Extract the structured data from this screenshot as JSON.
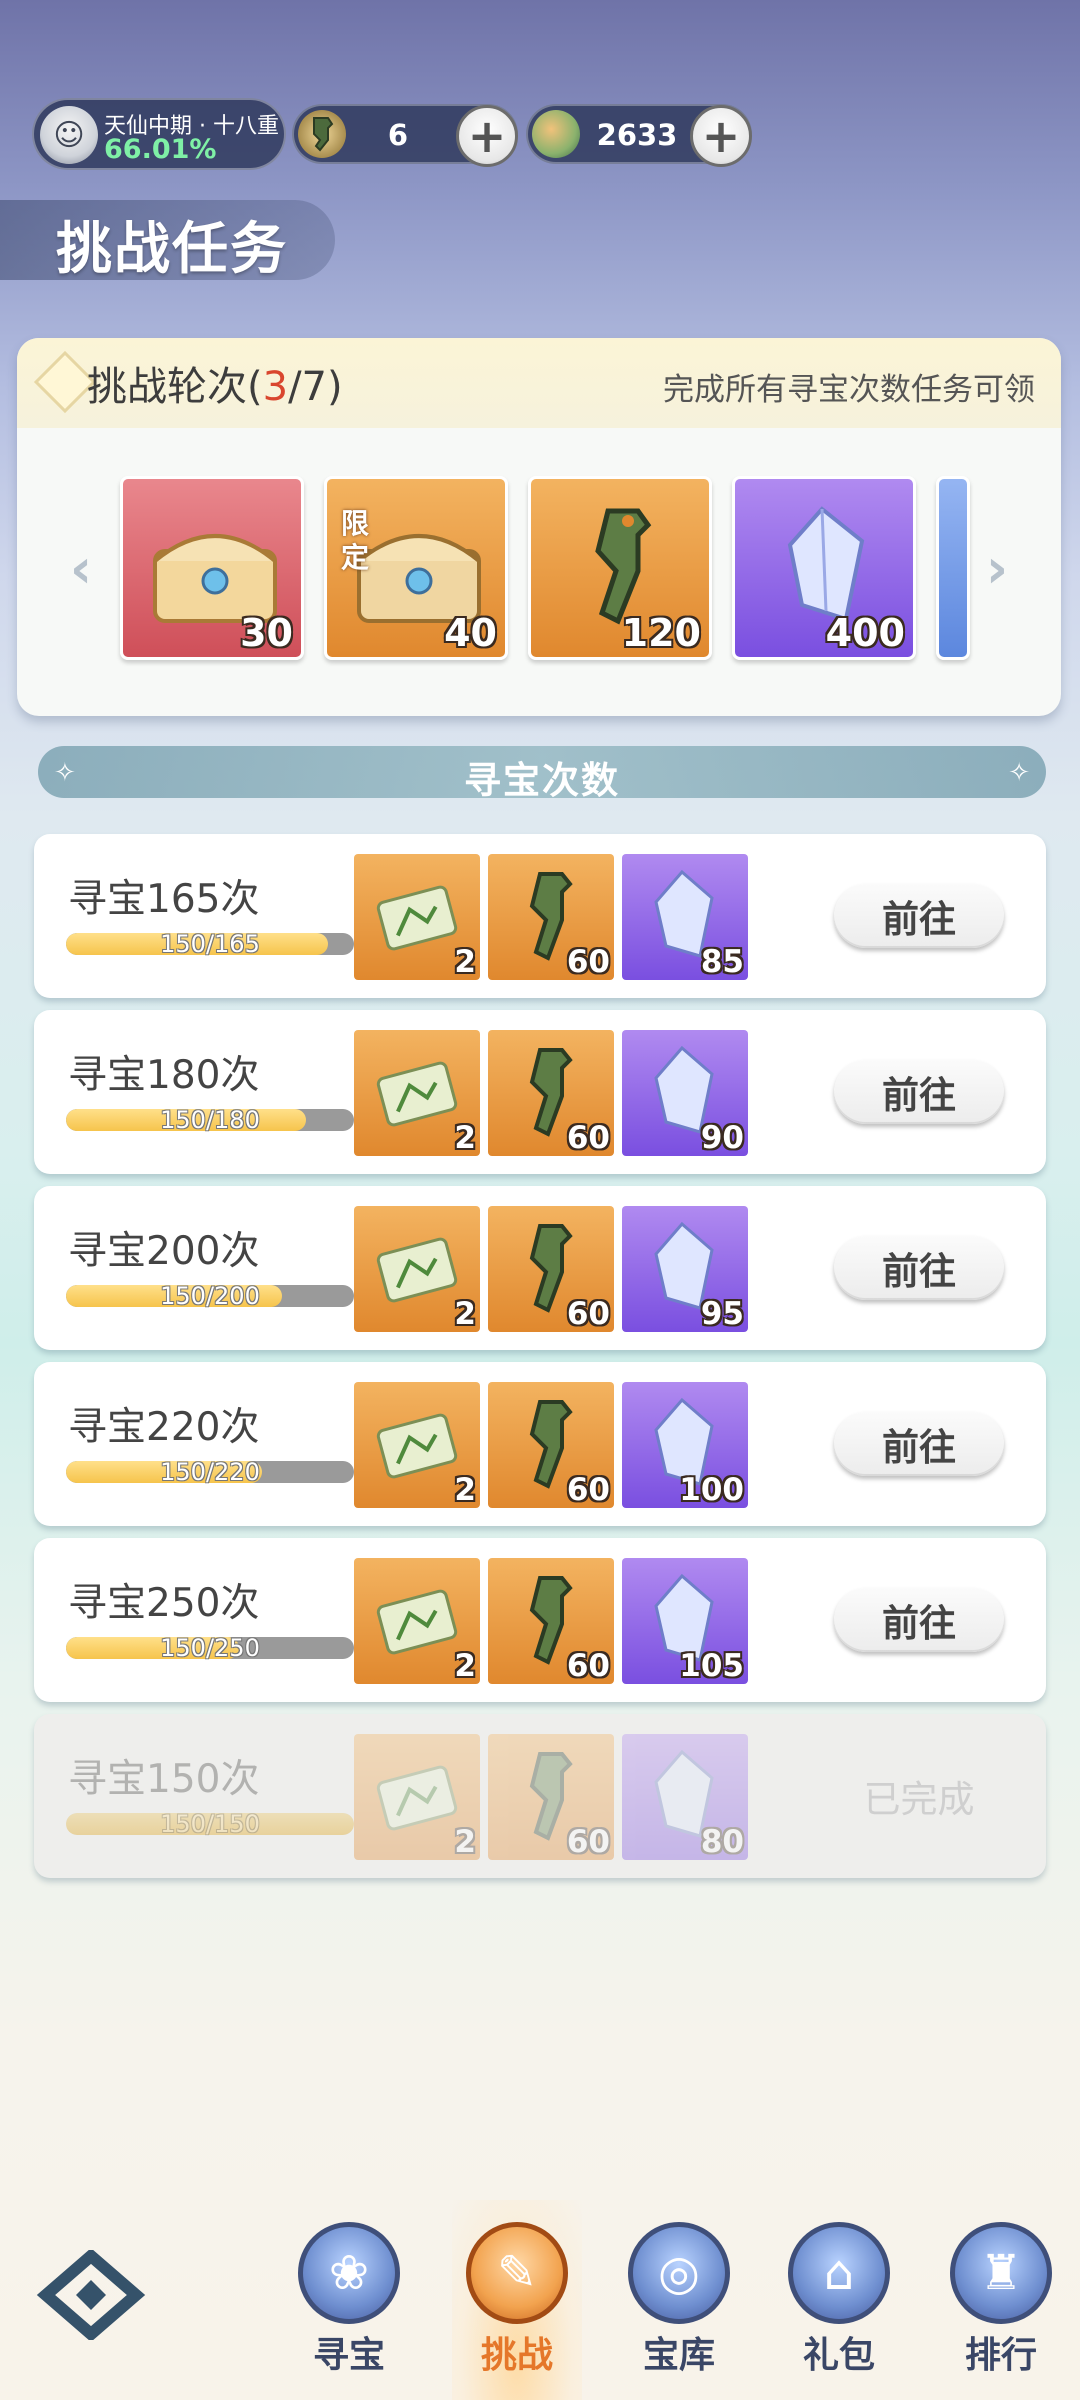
{
  "header": {
    "realm": {
      "name": "天仙中期 · 十八重",
      "percent": "66.01%"
    },
    "resources": [
      {
        "icon": "token-icon",
        "value": "6"
      },
      {
        "icon": "spirit-coin-icon",
        "value": "2633"
      }
    ],
    "page_title": "挑战任务"
  },
  "round": {
    "label": "挑战轮次(",
    "current": "3",
    "sep": "/",
    "total": "7",
    "close": ")",
    "hint": "完成所有寻宝次数任务可领",
    "rewards": [
      {
        "icon": "treasure-chest-icon",
        "count": "30",
        "bg": "red"
      },
      {
        "icon": "limited-chest-icon",
        "count": "40",
        "bg": "orange",
        "tag": "限定"
      },
      {
        "icon": "jade-token-icon",
        "count": "120",
        "bg": "orange"
      },
      {
        "icon": "crystal-icon",
        "count": "400",
        "bg": "purple"
      }
    ]
  },
  "section": {
    "title": "寻宝次数"
  },
  "tasks": [
    {
      "name": "寻宝165次",
      "progress": "150/165",
      "fraction": 0.909,
      "rewards": [
        "2",
        "60",
        "85"
      ],
      "action": "前往"
    },
    {
      "name": "寻宝180次",
      "progress": "150/180",
      "fraction": 0.833,
      "rewards": [
        "2",
        "60",
        "90"
      ],
      "action": "前往"
    },
    {
      "name": "寻宝200次",
      "progress": "150/200",
      "fraction": 0.75,
      "rewards": [
        "2",
        "60",
        "95"
      ],
      "action": "前往"
    },
    {
      "name": "寻宝220次",
      "progress": "150/220",
      "fraction": 0.682,
      "rewards": [
        "2",
        "60",
        "100"
      ],
      "action": "前往"
    },
    {
      "name": "寻宝250次",
      "progress": "150/250",
      "fraction": 0.6,
      "rewards": [
        "2",
        "60",
        "105"
      ],
      "action": "前往"
    },
    {
      "name": "寻宝150次",
      "progress": "150/150",
      "fraction": 1.0,
      "rewards": [
        "2",
        "60",
        "80"
      ],
      "action": "已完成",
      "done": true
    }
  ],
  "nav": [
    {
      "label": "寻宝",
      "icon": "treasure-bag-icon"
    },
    {
      "label": "挑战",
      "icon": "scroll-icon",
      "active": true
    },
    {
      "label": "宝库",
      "icon": "vault-icon"
    },
    {
      "label": "礼包",
      "icon": "gift-pack-icon"
    },
    {
      "label": "排行",
      "icon": "ranking-icon"
    }
  ]
}
